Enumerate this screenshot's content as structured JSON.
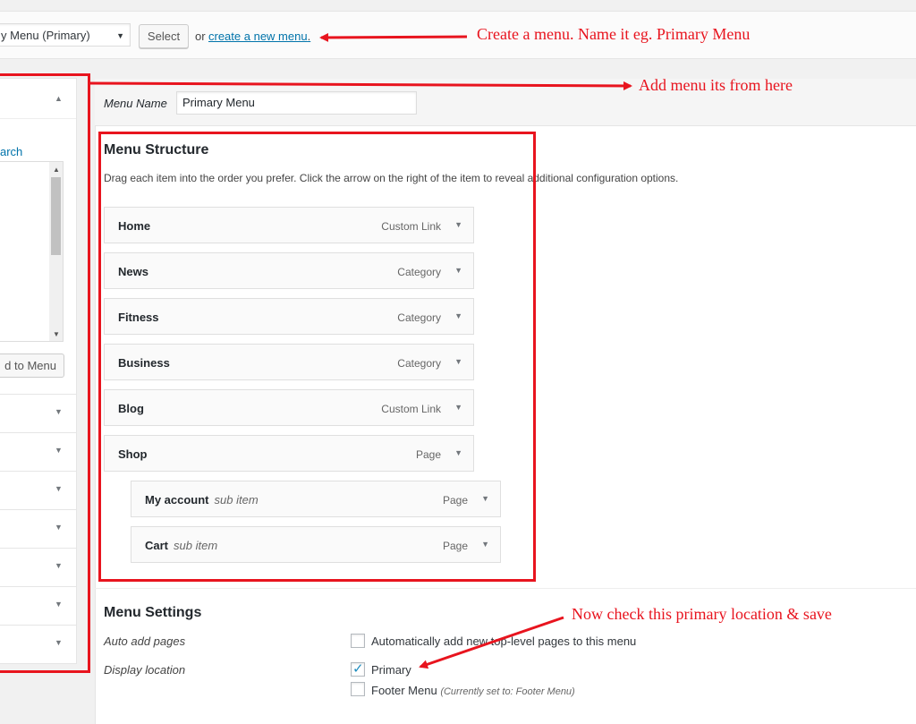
{
  "top": {
    "menu_select_value": "y Menu (Primary)",
    "select_button": "Select",
    "or_text": "or",
    "create_link": "create a new menu",
    "create_link_suffix": "."
  },
  "left_panel": {
    "search_tab": "arch",
    "add_button": "d to Menu"
  },
  "menu_name": {
    "label": "Menu Name",
    "value": "Primary Menu"
  },
  "structure": {
    "heading": "Menu Structure",
    "description": "Drag each item into the order you prefer. Click the arrow on the right of the item to reveal additional configuration options.",
    "items": [
      {
        "title": "Home",
        "sub": "",
        "type": "Custom Link"
      },
      {
        "title": "News",
        "sub": "",
        "type": "Category"
      },
      {
        "title": "Fitness",
        "sub": "",
        "type": "Category"
      },
      {
        "title": "Business",
        "sub": "",
        "type": "Category"
      },
      {
        "title": "Blog",
        "sub": "",
        "type": "Custom Link"
      },
      {
        "title": "Shop",
        "sub": "",
        "type": "Page"
      },
      {
        "title": "My account",
        "sub": "sub item",
        "type": "Page"
      },
      {
        "title": "Cart",
        "sub": "sub item",
        "type": "Page"
      }
    ]
  },
  "settings": {
    "heading": "Menu Settings",
    "auto_add_label": "Auto add pages",
    "auto_add_text": "Automatically add new top-level pages to this menu",
    "display_location_label": "Display location",
    "primary_text": "Primary",
    "footer_text": "Footer Menu",
    "footer_note": "(Currently set to: Footer Menu)"
  },
  "annotations": {
    "create": "Create a menu. Name it eg. Primary Menu",
    "add": "Add menu its from here",
    "check": "Now check this primary location & save"
  },
  "colors": {
    "annotation_red": "#e8141e",
    "link_blue": "#0073aa"
  }
}
